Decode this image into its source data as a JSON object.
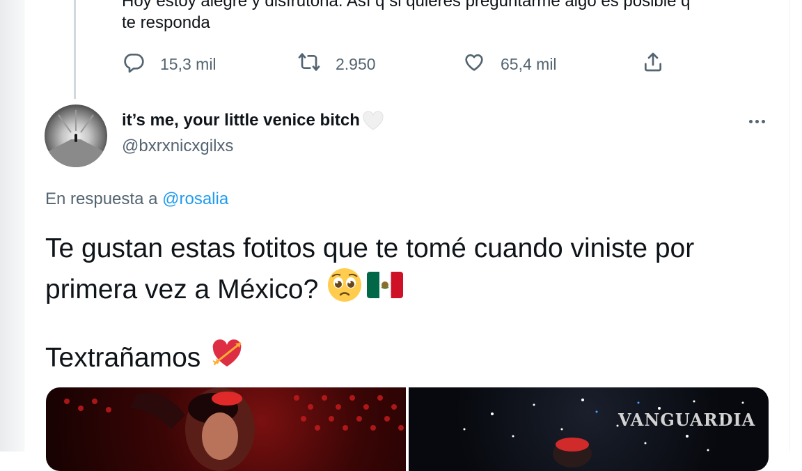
{
  "previous_tweet": {
    "text_line1": "Hoy estoy alegre y disfrutona. Así q si quieres preguntarme algo es posible q",
    "text_line2": "te responda",
    "reply_count": "15,3 mil",
    "retweet_count": "2.950",
    "like_count": "65,4 mil",
    "icons": {
      "reply": "reply-icon",
      "retweet": "retweet-icon",
      "like": "like-icon",
      "share": "share-icon"
    }
  },
  "tweet": {
    "author": {
      "display_name": "it’s me, your little venice bitch",
      "handle": "@bxrxnicxgilxs",
      "avatar": "avatar-photo"
    },
    "reply_to_label": "En respuesta a",
    "reply_to_handle": "@rosalia",
    "text_line1": "Te gustan estas fotitos que te tomé cuando viniste por",
    "text_line2": "primera vez a México?",
    "text_line3": "Textrañamos",
    "emojis": [
      "pleading-face-emoji",
      "mexico-flag-emoji",
      "heart-with-arrow-emoji"
    ],
    "more_icon": "more-options-icon"
  },
  "watermark": "VANGUARDIA",
  "colors": {
    "secondary_text": "#536471",
    "link": "#1d9bf0",
    "primary_text": "#0f1419"
  }
}
